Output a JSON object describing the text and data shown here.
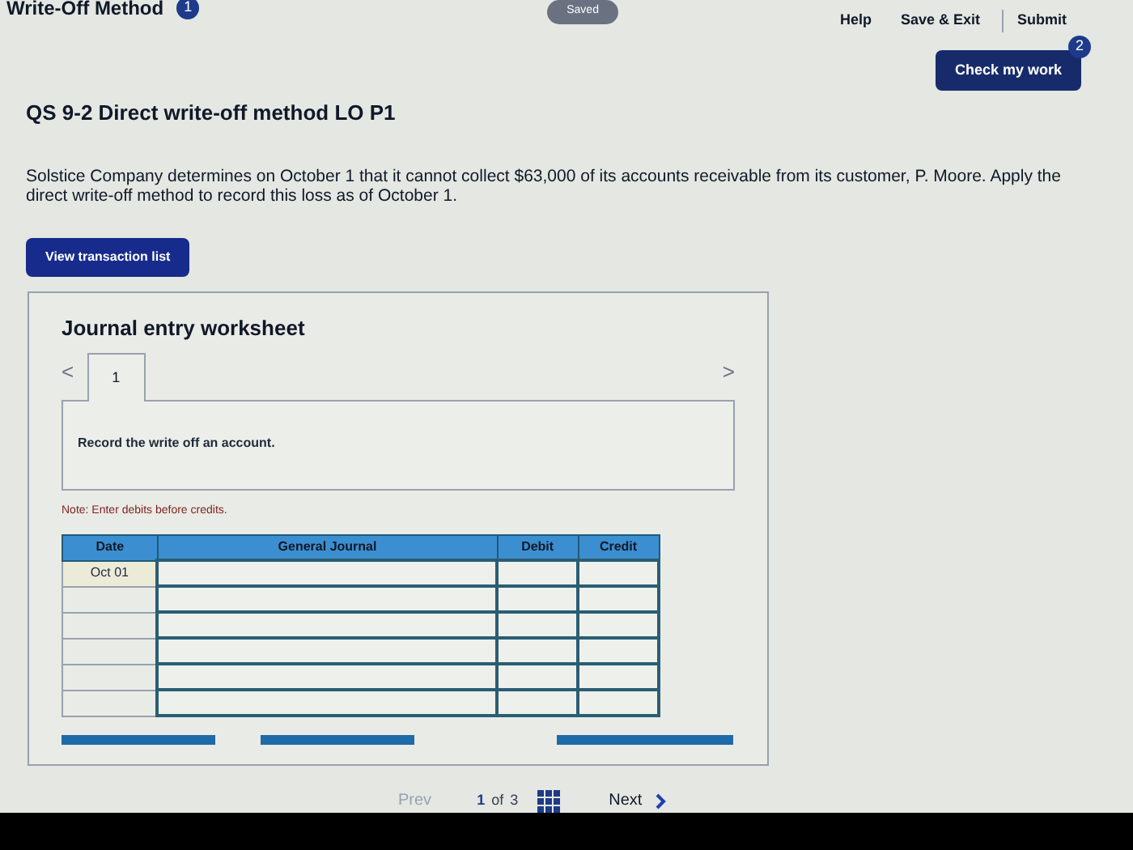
{
  "header": {
    "title": "Write-Off Method",
    "badge": "1",
    "status": "Saved"
  },
  "nav_links": [
    "Help",
    "Save & Exit",
    "Submit"
  ],
  "check_button": {
    "label": "Check my work",
    "badge": "2"
  },
  "question": {
    "title": "QS 9-2 Direct write-off method LO P1",
    "text": "Solstice Company determines on October 1 that it cannot collect $63,000 of its accounts receivable from its customer, P. Moore. Apply the direct write-off method to record this loss as of October 1."
  },
  "transaction_button": "View transaction list",
  "worksheet": {
    "title": "Journal entry worksheet",
    "prev_arrow": "<",
    "next_arrow": ">",
    "tabs": [
      {
        "label": "1",
        "selected": true
      }
    ],
    "instruction": "Record the write off an account.",
    "note": "Note: Enter debits before credits.",
    "table": {
      "columns": [
        "Date",
        "General Journal",
        "Debit",
        "Credit"
      ],
      "rows": [
        {
          "date": "Oct 01"
        },
        {},
        {},
        {},
        {},
        {}
      ]
    }
  },
  "pagination": {
    "prev": {
      "label": "Prev",
      "disabled": true
    },
    "current": "1",
    "separator": "of",
    "total": "3",
    "next": "Next"
  }
}
